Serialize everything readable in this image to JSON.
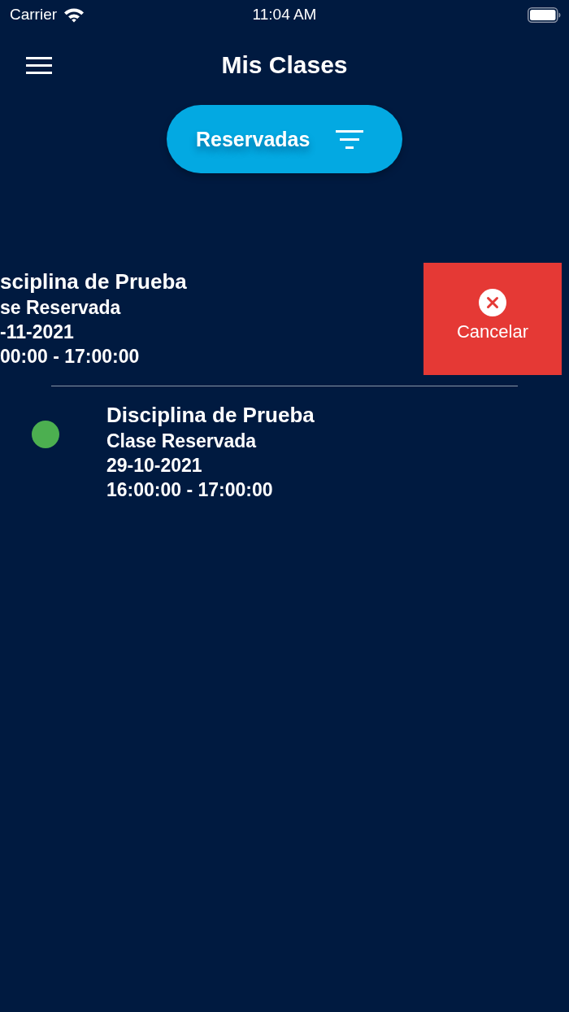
{
  "status_bar": {
    "carrier": "Carrier",
    "time": "11:04 AM"
  },
  "header": {
    "title": "Mis Clases"
  },
  "filter_button": {
    "label": "Reservadas"
  },
  "classes": [
    {
      "kind": "swiped",
      "title": "sciplina de Prueba",
      "type": "se Reservada",
      "date": "-11-2021",
      "time": "00:00 - 17:00:00",
      "action": {
        "label": "Cancelar"
      }
    },
    {
      "kind": "normal",
      "color": "#4caf50",
      "title": "Disciplina de Prueba",
      "type": "Clase Reservada",
      "date": "29-10-2021",
      "time": "16:00:00 - 17:00:00"
    }
  ]
}
